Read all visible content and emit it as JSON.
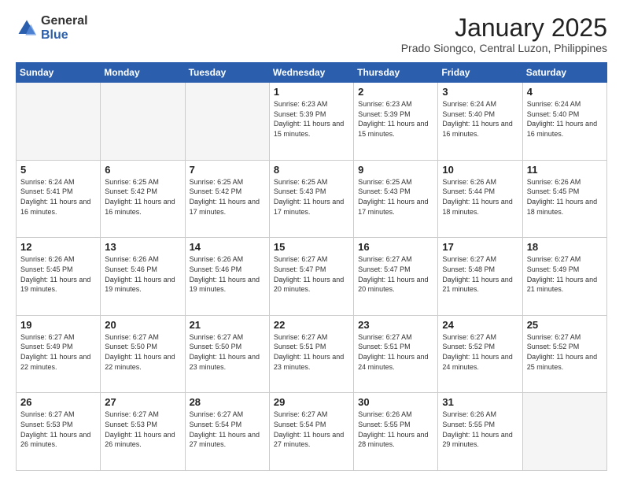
{
  "header": {
    "logo_general": "General",
    "logo_blue": "Blue",
    "month_title": "January 2025",
    "location": "Prado Siongco, Central Luzon, Philippines"
  },
  "weekdays": [
    "Sunday",
    "Monday",
    "Tuesday",
    "Wednesday",
    "Thursday",
    "Friday",
    "Saturday"
  ],
  "weeks": [
    [
      {
        "day": "",
        "sunrise": "",
        "sunset": "",
        "daylight": "",
        "empty": true
      },
      {
        "day": "",
        "sunrise": "",
        "sunset": "",
        "daylight": "",
        "empty": true
      },
      {
        "day": "",
        "sunrise": "",
        "sunset": "",
        "daylight": "",
        "empty": true
      },
      {
        "day": "1",
        "sunrise": "Sunrise: 6:23 AM",
        "sunset": "Sunset: 5:39 PM",
        "daylight": "Daylight: 11 hours and 15 minutes."
      },
      {
        "day": "2",
        "sunrise": "Sunrise: 6:23 AM",
        "sunset": "Sunset: 5:39 PM",
        "daylight": "Daylight: 11 hours and 15 minutes."
      },
      {
        "day": "3",
        "sunrise": "Sunrise: 6:24 AM",
        "sunset": "Sunset: 5:40 PM",
        "daylight": "Daylight: 11 hours and 16 minutes."
      },
      {
        "day": "4",
        "sunrise": "Sunrise: 6:24 AM",
        "sunset": "Sunset: 5:40 PM",
        "daylight": "Daylight: 11 hours and 16 minutes."
      }
    ],
    [
      {
        "day": "5",
        "sunrise": "Sunrise: 6:24 AM",
        "sunset": "Sunset: 5:41 PM",
        "daylight": "Daylight: 11 hours and 16 minutes."
      },
      {
        "day": "6",
        "sunrise": "Sunrise: 6:25 AM",
        "sunset": "Sunset: 5:42 PM",
        "daylight": "Daylight: 11 hours and 16 minutes."
      },
      {
        "day": "7",
        "sunrise": "Sunrise: 6:25 AM",
        "sunset": "Sunset: 5:42 PM",
        "daylight": "Daylight: 11 hours and 17 minutes."
      },
      {
        "day": "8",
        "sunrise": "Sunrise: 6:25 AM",
        "sunset": "Sunset: 5:43 PM",
        "daylight": "Daylight: 11 hours and 17 minutes."
      },
      {
        "day": "9",
        "sunrise": "Sunrise: 6:25 AM",
        "sunset": "Sunset: 5:43 PM",
        "daylight": "Daylight: 11 hours and 17 minutes."
      },
      {
        "day": "10",
        "sunrise": "Sunrise: 6:26 AM",
        "sunset": "Sunset: 5:44 PM",
        "daylight": "Daylight: 11 hours and 18 minutes."
      },
      {
        "day": "11",
        "sunrise": "Sunrise: 6:26 AM",
        "sunset": "Sunset: 5:45 PM",
        "daylight": "Daylight: 11 hours and 18 minutes."
      }
    ],
    [
      {
        "day": "12",
        "sunrise": "Sunrise: 6:26 AM",
        "sunset": "Sunset: 5:45 PM",
        "daylight": "Daylight: 11 hours and 19 minutes."
      },
      {
        "day": "13",
        "sunrise": "Sunrise: 6:26 AM",
        "sunset": "Sunset: 5:46 PM",
        "daylight": "Daylight: 11 hours and 19 minutes."
      },
      {
        "day": "14",
        "sunrise": "Sunrise: 6:26 AM",
        "sunset": "Sunset: 5:46 PM",
        "daylight": "Daylight: 11 hours and 19 minutes."
      },
      {
        "day": "15",
        "sunrise": "Sunrise: 6:27 AM",
        "sunset": "Sunset: 5:47 PM",
        "daylight": "Daylight: 11 hours and 20 minutes."
      },
      {
        "day": "16",
        "sunrise": "Sunrise: 6:27 AM",
        "sunset": "Sunset: 5:47 PM",
        "daylight": "Daylight: 11 hours and 20 minutes."
      },
      {
        "day": "17",
        "sunrise": "Sunrise: 6:27 AM",
        "sunset": "Sunset: 5:48 PM",
        "daylight": "Daylight: 11 hours and 21 minutes."
      },
      {
        "day": "18",
        "sunrise": "Sunrise: 6:27 AM",
        "sunset": "Sunset: 5:49 PM",
        "daylight": "Daylight: 11 hours and 21 minutes."
      }
    ],
    [
      {
        "day": "19",
        "sunrise": "Sunrise: 6:27 AM",
        "sunset": "Sunset: 5:49 PM",
        "daylight": "Daylight: 11 hours and 22 minutes."
      },
      {
        "day": "20",
        "sunrise": "Sunrise: 6:27 AM",
        "sunset": "Sunset: 5:50 PM",
        "daylight": "Daylight: 11 hours and 22 minutes."
      },
      {
        "day": "21",
        "sunrise": "Sunrise: 6:27 AM",
        "sunset": "Sunset: 5:50 PM",
        "daylight": "Daylight: 11 hours and 23 minutes."
      },
      {
        "day": "22",
        "sunrise": "Sunrise: 6:27 AM",
        "sunset": "Sunset: 5:51 PM",
        "daylight": "Daylight: 11 hours and 23 minutes."
      },
      {
        "day": "23",
        "sunrise": "Sunrise: 6:27 AM",
        "sunset": "Sunset: 5:51 PM",
        "daylight": "Daylight: 11 hours and 24 minutes."
      },
      {
        "day": "24",
        "sunrise": "Sunrise: 6:27 AM",
        "sunset": "Sunset: 5:52 PM",
        "daylight": "Daylight: 11 hours and 24 minutes."
      },
      {
        "day": "25",
        "sunrise": "Sunrise: 6:27 AM",
        "sunset": "Sunset: 5:52 PM",
        "daylight": "Daylight: 11 hours and 25 minutes."
      }
    ],
    [
      {
        "day": "26",
        "sunrise": "Sunrise: 6:27 AM",
        "sunset": "Sunset: 5:53 PM",
        "daylight": "Daylight: 11 hours and 26 minutes."
      },
      {
        "day": "27",
        "sunrise": "Sunrise: 6:27 AM",
        "sunset": "Sunset: 5:53 PM",
        "daylight": "Daylight: 11 hours and 26 minutes."
      },
      {
        "day": "28",
        "sunrise": "Sunrise: 6:27 AM",
        "sunset": "Sunset: 5:54 PM",
        "daylight": "Daylight: 11 hours and 27 minutes."
      },
      {
        "day": "29",
        "sunrise": "Sunrise: 6:27 AM",
        "sunset": "Sunset: 5:54 PM",
        "daylight": "Daylight: 11 hours and 27 minutes."
      },
      {
        "day": "30",
        "sunrise": "Sunrise: 6:26 AM",
        "sunset": "Sunset: 5:55 PM",
        "daylight": "Daylight: 11 hours and 28 minutes."
      },
      {
        "day": "31",
        "sunrise": "Sunrise: 6:26 AM",
        "sunset": "Sunset: 5:55 PM",
        "daylight": "Daylight: 11 hours and 29 minutes."
      },
      {
        "day": "",
        "sunrise": "",
        "sunset": "",
        "daylight": "",
        "empty": true
      }
    ]
  ]
}
